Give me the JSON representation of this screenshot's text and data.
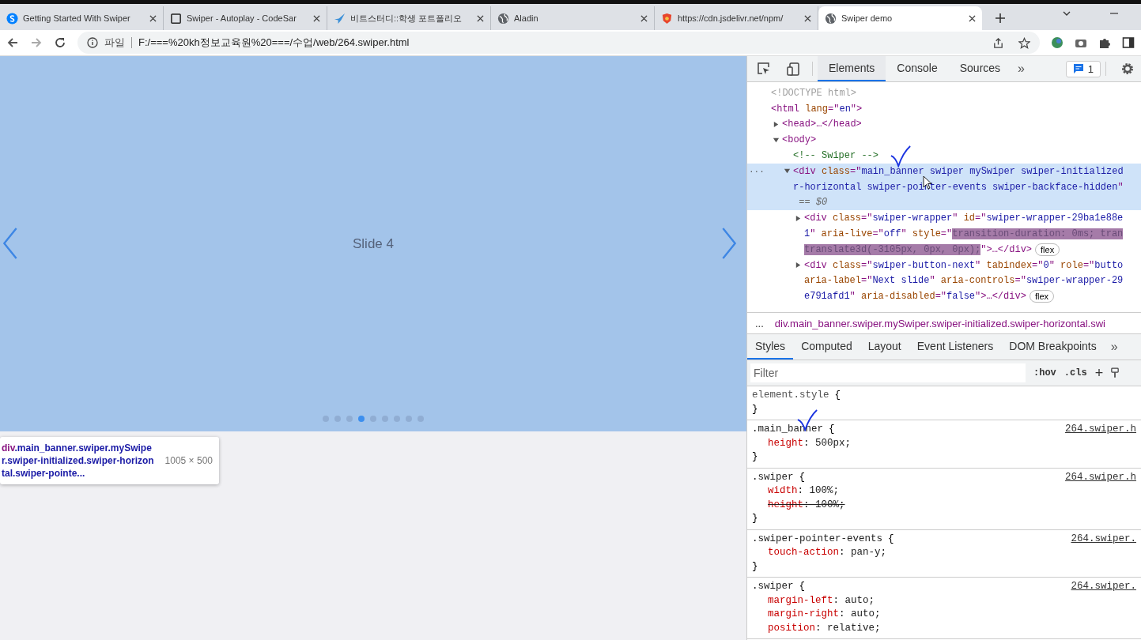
{
  "browser": {
    "tabs": [
      {
        "title": "Getting Started With Swiper",
        "selected": false
      },
      {
        "title": "Swiper - Autoplay - CodeSar",
        "selected": false
      },
      {
        "title": "비트스터디::학생 포트폴리오",
        "selected": false
      },
      {
        "title": "Aladin",
        "selected": false
      },
      {
        "title": "https://cdn.jsdelivr.net/npm/",
        "selected": false
      },
      {
        "title": "Swiper demo",
        "selected": true
      }
    ],
    "address": {
      "scheme_label": "파일",
      "url": "F:/===%20kh정보교육원%20===/수업/web/264.swiper.html"
    }
  },
  "page": {
    "slide_text": "Slide 4",
    "pagination": [
      {
        "selected": false
      },
      {
        "selected": false
      },
      {
        "selected": false
      },
      {
        "selected": true
      },
      {
        "selected": false
      },
      {
        "selected": false
      },
      {
        "selected": false
      },
      {
        "selected": false
      },
      {
        "selected": false
      }
    ],
    "tooltip": {
      "tag": "div",
      "selector": ".main_banner.swiper.mySwiper.swiper-initialized.swiper-horizontal.swiper-pointe...",
      "size": "1005 × 500"
    }
  },
  "devtools": {
    "tabs": [
      {
        "label": "Elements",
        "selected": true
      },
      {
        "label": "Console",
        "selected": false
      },
      {
        "label": "Sources",
        "selected": false
      }
    ],
    "more": "»",
    "issues": "1",
    "dom_tree": [
      {
        "selected": false,
        "lines": [
          {
            "segments": [
              {
                "kind": "doctype",
                "text": "<!DOCTYPE html>"
              }
            ]
          }
        ]
      },
      {
        "selected": false,
        "lines": [
          {
            "segments": [
              {
                "kind": "tag",
                "text": "<html"
              },
              {
                "kind": "attr",
                "text": " lang"
              },
              {
                "kind": "tag",
                "text": "=\""
              },
              {
                "kind": "value",
                "text": "en"
              },
              {
                "kind": "tag",
                "text": "\">"
              }
            ]
          }
        ],
        "children": [
          {
            "selected": false,
            "expanded": false,
            "lines": [
              {
                "segments": [
                  {
                    "kind": "tag",
                    "text": "<head>…</head>"
                  }
                ]
              }
            ]
          },
          {
            "selected": false,
            "expanded": true,
            "lines": [
              {
                "segments": [
                  {
                    "kind": "tag",
                    "text": "<body>"
                  }
                ]
              }
            ],
            "children": [
              {
                "selected": false,
                "lines": [
                  {
                    "segments": [
                      {
                        "kind": "comment",
                        "text": "<!-- Swiper -->"
                      }
                    ]
                  }
                ]
              },
              {
                "selected": true,
                "expanded": true,
                "more": "···",
                "lines": [
                  {
                    "segments": [
                      {
                        "kind": "tag",
                        "text": "<div"
                      },
                      {
                        "kind": "attr",
                        "text": " class"
                      },
                      {
                        "kind": "tag",
                        "text": "=\""
                      },
                      {
                        "kind": "value",
                        "text": "main_banner swiper mySwiper swiper-initialized"
                      }
                    ]
                  },
                  {
                    "segments": [
                      {
                        "kind": "value",
                        "text": "r-horizontal swiper-pointer-events swiper-backface-hidden"
                      },
                      {
                        "kind": "tag",
                        "text": "\""
                      }
                    ]
                  },
                  {
                    "segments": [
                      {
                        "kind": "dim",
                        "text": " == $0"
                      }
                    ]
                  }
                ],
                "children": [
                  {
                    "selected": false,
                    "expanded": false,
                    "lines": [
                      {
                        "segments": [
                          {
                            "kind": "tag",
                            "text": "<div"
                          },
                          {
                            "kind": "attr",
                            "text": " class"
                          },
                          {
                            "kind": "tag",
                            "text": "=\""
                          },
                          {
                            "kind": "value",
                            "text": "swiper-wrapper"
                          },
                          {
                            "kind": "tag",
                            "text": "\""
                          },
                          {
                            "kind": "attr",
                            "text": " id"
                          },
                          {
                            "kind": "tag",
                            "text": "=\""
                          },
                          {
                            "kind": "value",
                            "text": "swiper-wrapper-29ba1e88e"
                          }
                        ]
                      },
                      {
                        "segments": [
                          {
                            "kind": "value",
                            "text": "1"
                          },
                          {
                            "kind": "tag",
                            "text": "\""
                          },
                          {
                            "kind": "attr",
                            "text": " aria-live"
                          },
                          {
                            "kind": "tag",
                            "text": "=\""
                          },
                          {
                            "kind": "value",
                            "text": "off"
                          },
                          {
                            "kind": "tag",
                            "text": "\""
                          },
                          {
                            "kind": "attr",
                            "text": " style"
                          },
                          {
                            "kind": "tag",
                            "text": "=\""
                          },
                          {
                            "kind": "highlight",
                            "text": "transition-duration: 0ms; tran"
                          }
                        ]
                      },
                      {
                        "badge": "flex",
                        "segments": [
                          {
                            "kind": "highlight",
                            "text": "translate3d(-3105px, 0px, 0px);"
                          },
                          {
                            "kind": "tag",
                            "text": "\">…</div>"
                          }
                        ]
                      }
                    ]
                  },
                  {
                    "selected": false,
                    "expanded": false,
                    "lines": [
                      {
                        "segments": [
                          {
                            "kind": "tag",
                            "text": "<div"
                          },
                          {
                            "kind": "attr",
                            "text": " class"
                          },
                          {
                            "kind": "tag",
                            "text": "=\""
                          },
                          {
                            "kind": "value",
                            "text": "swiper-button-next"
                          },
                          {
                            "kind": "tag",
                            "text": "\""
                          },
                          {
                            "kind": "attr",
                            "text": " tabindex"
                          },
                          {
                            "kind": "tag",
                            "text": "=\""
                          },
                          {
                            "kind": "value",
                            "text": "0"
                          },
                          {
                            "kind": "tag",
                            "text": "\""
                          },
                          {
                            "kind": "attr",
                            "text": " role"
                          },
                          {
                            "kind": "tag",
                            "text": "=\""
                          },
                          {
                            "kind": "value",
                            "text": "butto"
                          }
                        ]
                      },
                      {
                        "segments": [
                          {
                            "kind": "attr",
                            "text": "aria-label"
                          },
                          {
                            "kind": "tag",
                            "text": "=\""
                          },
                          {
                            "kind": "value",
                            "text": "Next slide"
                          },
                          {
                            "kind": "tag",
                            "text": "\""
                          },
                          {
                            "kind": "attr",
                            "text": " aria-controls"
                          },
                          {
                            "kind": "tag",
                            "text": "=\""
                          },
                          {
                            "kind": "value",
                            "text": "swiper-wrapper-29"
                          }
                        ]
                      },
                      {
                        "badge": "flex",
                        "segments": [
                          {
                            "kind": "value",
                            "text": "e791afd1"
                          },
                          {
                            "kind": "tag",
                            "text": "\""
                          },
                          {
                            "kind": "attr",
                            "text": " aria-disabled"
                          },
                          {
                            "kind": "tag",
                            "text": "=\""
                          },
                          {
                            "kind": "value",
                            "text": "false"
                          },
                          {
                            "kind": "tag",
                            "text": "\">…</div>"
                          }
                        ]
                      }
                    ]
                  }
                ]
              }
            ]
          }
        ]
      }
    ],
    "breadcrumb": {
      "ellipsis": "...",
      "path": "div.main_banner.swiper.mySwiper.swiper-initialized.swiper-horizontal.swi"
    },
    "styles_tabs": [
      {
        "label": "Styles",
        "selected": true
      },
      {
        "label": "Computed",
        "selected": false
      },
      {
        "label": "Layout",
        "selected": false
      },
      {
        "label": "Event Listeners",
        "selected": false
      },
      {
        "label": "DOM Breakpoints",
        "selected": false
      }
    ],
    "styles_more": "»",
    "filter": {
      "placeholder": "Filter",
      "hov": ":hov",
      "cls": ".cls",
      "add": "+"
    },
    "rules": [
      {
        "selector": "element.style",
        "inline": true,
        "open": "{",
        "close": "}"
      },
      {
        "selector": ".main_banner",
        "inline": false,
        "source": "264.swiper.h",
        "open": "{",
        "close": "}",
        "declarations": [
          {
            "property": "height",
            "colon": ":",
            "value": "500px;",
            "struck": false
          }
        ]
      },
      {
        "selector": ".swiper",
        "inline": false,
        "source": "264.swiper.h",
        "open": "{",
        "close": "}",
        "declarations": [
          {
            "property": "width",
            "colon": ":",
            "value": "100%;",
            "struck": false
          },
          {
            "property": "height",
            "colon": ":",
            "value": "100%;",
            "struck": true
          }
        ]
      },
      {
        "selector": ".swiper-pointer-events",
        "inline": false,
        "source": "264.swiper.",
        "open": "{",
        "close": "}",
        "declarations": [
          {
            "property": "touch-action",
            "colon": ":",
            "value": "pan-y;",
            "struck": false
          }
        ]
      },
      {
        "selector": ".swiper",
        "inline": false,
        "source": "264.swiper.",
        "open": "{",
        "declarations": [
          {
            "property": "margin-left",
            "colon": ":",
            "value": "auto;",
            "struck": false
          },
          {
            "property": "margin-right",
            "colon": ":",
            "value": "auto;",
            "struck": false
          },
          {
            "property": "position",
            "colon": ":",
            "value": "relative;",
            "struck": false
          }
        ]
      }
    ]
  }
}
